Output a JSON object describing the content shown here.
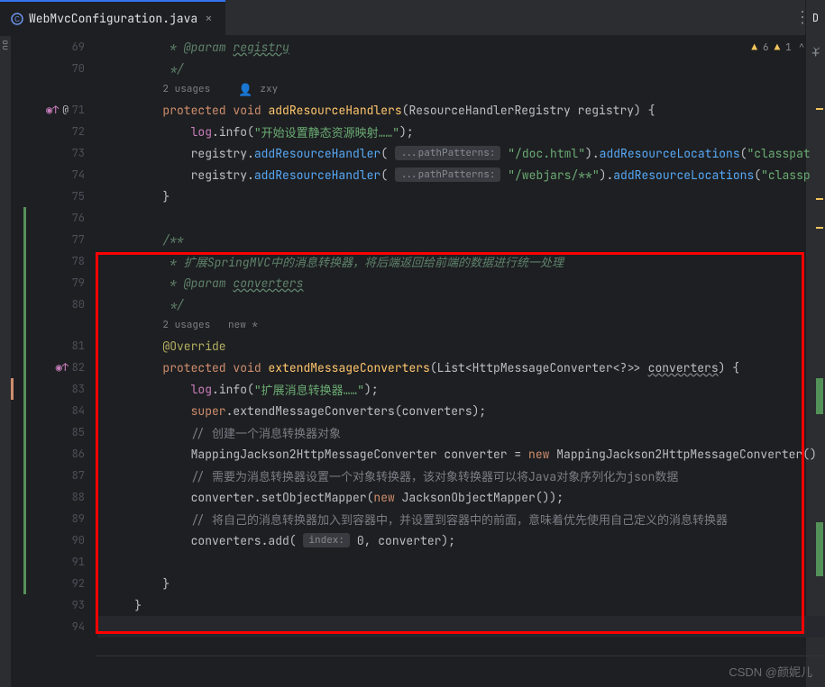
{
  "tab": {
    "filename": "WebMvcConfiguration.java"
  },
  "inspections": {
    "warn1_count": "6",
    "warn2_count": "1"
  },
  "right_panel": {
    "label": "D",
    "plus": "+"
  },
  "left_strip": "ou",
  "watermark": "CSDN @颜妮儿",
  "hints": {
    "usages1": "2 usages",
    "author": "zxy",
    "usages2": "2 usages   new *"
  },
  "lines": {
    "l69_a": "         * @param ",
    "l69_b": "registry",
    "l70": "         */",
    "l71_kw1": "protected",
    "l71_kw2": "void",
    "l71_m": "addResourceHandlers",
    "l71_p": "(ResourceHandlerRegistry registry) {",
    "l72_f": "log",
    "l72_m": ".info(",
    "l72_s": "\"开始设置静态资源映射……\"",
    "l72_e": ");",
    "l73_a": "            registry.",
    "l73_m": "addResourceHandler",
    "l73_b": "( ",
    "l73_h": "...pathPatterns:",
    "l73_s": " \"/doc.html\"",
    "l73_c": ").",
    "l73_m2": "addResourceLocations",
    "l73_d": "(",
    "l73_s2": "\"classpat",
    "l74_a": "            registry.",
    "l74_m": "addResourceHandler",
    "l74_b": "( ",
    "l74_h": "...pathPatterns:",
    "l74_s": " \"/webjars/**\"",
    "l74_c": ").",
    "l74_m2": "addResourceLocations",
    "l74_d": "(",
    "l74_s2": "\"classp",
    "l75": "        }",
    "l77": "        /**",
    "l78": "         * 扩展SpringMVC中的消息转换器，将后端返回给前端的数据进行统一处理",
    "l79_a": "         * @param ",
    "l79_b": "converters",
    "l80": "         */",
    "l81": "@Override",
    "l82_kw1": "protected",
    "l82_kw2": "void",
    "l82_m": "extendMessageConverters",
    "l82_p1": "(List<HttpMessageConverter<?>> ",
    "l82_p2": "converters",
    "l82_p3": ") {",
    "l83_f": "log",
    "l83_m": ".info(",
    "l83_s": "\"扩展消息转换器……\"",
    "l83_e": ");",
    "l84_kw": "super",
    "l84_m": ".extendMessageConverters(converters);",
    "l85": "            // 创建一个消息转换器对象",
    "l86_a": "            MappingJackson2HttpMessageConverter converter = ",
    "l86_kw": "new",
    "l86_b": " MappingJackson2HttpMessageConverter()",
    "l87": "            // 需要为消息转换器设置一个对象转换器，该对象转换器可以将Java对象序列化为json数据",
    "l88_a": "            converter.setObjectMapper(",
    "l88_kw": "new",
    "l88_b": " JacksonObjectMapper());",
    "l89": "            // 将自己的消息转换器加入到容器中，并设置到容器中的前面，意味着优先使用自己定义的消息转换器",
    "l90_a": "            converters.add( ",
    "l90_h": "index:",
    "l90_b": " 0",
    "l90_c": ", converter);",
    "l92": "        }",
    "l93": "    }"
  },
  "line_numbers": [
    "69",
    "70",
    "71",
    "72",
    "73",
    "74",
    "75",
    "76",
    "77",
    "78",
    "79",
    "80",
    "81",
    "82",
    "83",
    "84",
    "85",
    "86",
    "87",
    "88",
    "89",
    "90",
    "91",
    "92",
    "93",
    "94"
  ]
}
